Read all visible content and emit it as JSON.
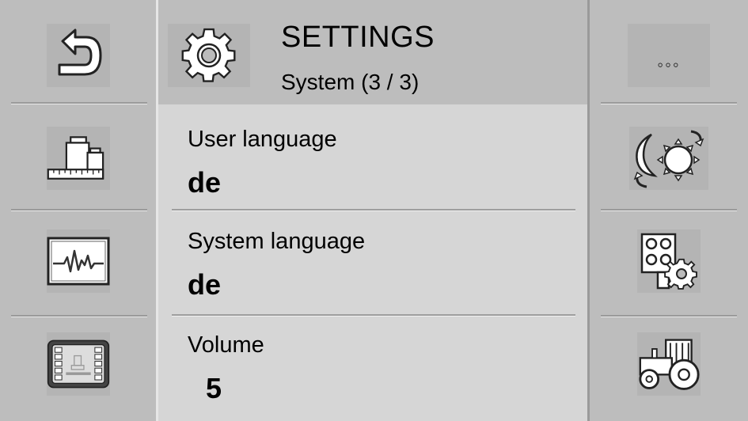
{
  "header": {
    "title": "SETTINGS",
    "subtitle": "System (3 / 3)"
  },
  "settings": [
    {
      "label": "User language",
      "value": "de"
    },
    {
      "label": "System language",
      "value": "de"
    },
    {
      "label": "Volume",
      "value": "5"
    }
  ],
  "right_menu": {
    "more_label": "◦◦◦"
  },
  "icons": {
    "left": [
      "back-arrow-icon",
      "weights-scale-icon",
      "heartbeat-monitor-icon",
      "machine-terminal-icon"
    ],
    "right": [
      "more-icon",
      "day-night-icon",
      "grid-gear-icon",
      "tractor-icon"
    ],
    "header": "gear-icon"
  },
  "colors": {
    "background": "#bdbdbd",
    "content_panel": "#d6d6d6",
    "icon_tile": "#b4b4b4"
  }
}
